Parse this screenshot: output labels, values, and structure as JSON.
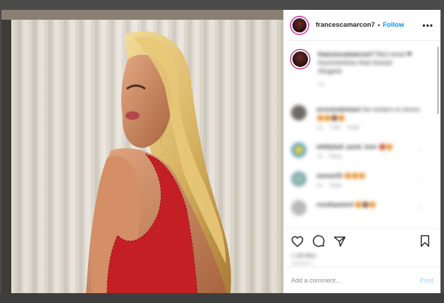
{
  "post": {
    "username": "francescamarcon7",
    "separator": "•",
    "follow_label": "Follow",
    "more_label": "•••",
    "caption": {
      "username": "francescamarcon7",
      "text": "Red mood ❤ #summertime #red #mood #lingerie",
      "time": "1w"
    },
    "comments": [
      {
        "username": "ernestodamiani",
        "text": "Sei sempre un amore",
        "time": "1w",
        "likes": "1 like",
        "reply": "Reply",
        "avatar_color": "#6f6a66"
      },
      {
        "username": "wildlyball_punti_love",
        "text": "",
        "time": "1w",
        "likes": "",
        "reply": "Reply",
        "avatar_color": "#5fa0c9"
      },
      {
        "username": "zanuar22",
        "text": "",
        "time": "1w",
        "likes": "",
        "reply": "Reply",
        "avatar_color": "#7fa8b9"
      },
      {
        "username": "rosafspazio4",
        "text": "",
        "time": "",
        "likes": "",
        "reply": "",
        "avatar_color": "#b9b9b9"
      }
    ],
    "likes_text": "1,166 likes",
    "date_text": "AUGUST 1",
    "add_comment_placeholder": "Add a comment...",
    "post_button": "Post",
    "icons": {
      "like": "heart-icon",
      "comment": "comment-icon",
      "share": "share-icon",
      "save": "bookmark-icon",
      "more": "more-icon"
    },
    "colors": {
      "link_blue": "#0095f6",
      "post_disabled": "#b3dbff",
      "story_ring": "#d6249f",
      "text": "#262626",
      "muted": "#8e8e8e"
    }
  }
}
